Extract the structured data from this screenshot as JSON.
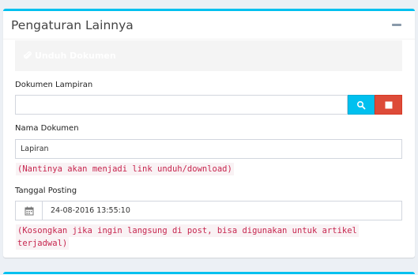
{
  "panel": {
    "title": "Pengaturan Lainnya",
    "collapse_icon": "minus-icon",
    "accent_color": "#00c0ef"
  },
  "download_button": {
    "label": "Unduh Dokumen",
    "icon": "paperclip-icon"
  },
  "attachment": {
    "label": "Dokumen Lampiran",
    "value": "",
    "search_icon": "search-icon",
    "clear_icon": "stop-icon"
  },
  "document_name": {
    "label": "Nama Dokumen",
    "value": "Lapiran",
    "hint": "(Nantinya akan menjadi link unduh/download)"
  },
  "posting_date": {
    "label": "Tanggal Posting",
    "value": "24-08-2016 13:55:10",
    "icon": "calendar-icon",
    "hint_line1": "(Kosongkan jika ingin langsung di post, bisa digunakan untuk artikel",
    "hint_line2": "terjadwal)"
  }
}
